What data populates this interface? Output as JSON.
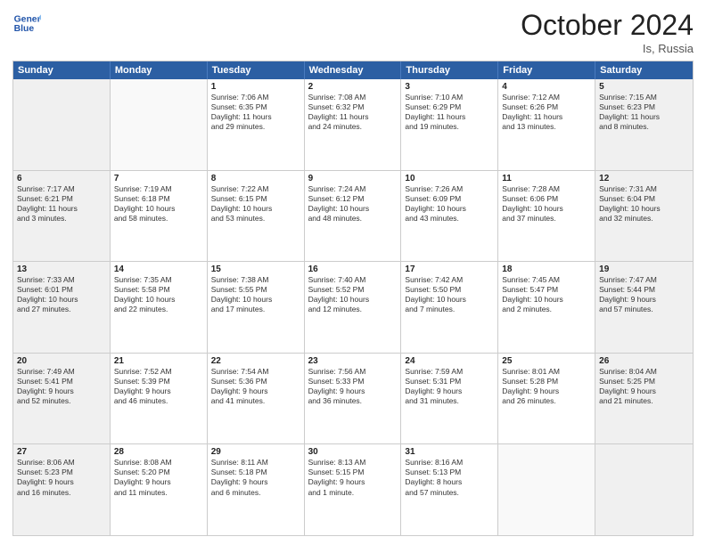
{
  "header": {
    "logo_line1": "General",
    "logo_line2": "Blue",
    "month": "October 2024",
    "location": "Is, Russia"
  },
  "days_of_week": [
    "Sunday",
    "Monday",
    "Tuesday",
    "Wednesday",
    "Thursday",
    "Friday",
    "Saturday"
  ],
  "weeks": [
    [
      {
        "day": "",
        "empty": true
      },
      {
        "day": "",
        "empty": true
      },
      {
        "day": "1",
        "lines": [
          "Sunrise: 7:06 AM",
          "Sunset: 6:35 PM",
          "Daylight: 11 hours",
          "and 29 minutes."
        ]
      },
      {
        "day": "2",
        "lines": [
          "Sunrise: 7:08 AM",
          "Sunset: 6:32 PM",
          "Daylight: 11 hours",
          "and 24 minutes."
        ]
      },
      {
        "day": "3",
        "lines": [
          "Sunrise: 7:10 AM",
          "Sunset: 6:29 PM",
          "Daylight: 11 hours",
          "and 19 minutes."
        ]
      },
      {
        "day": "4",
        "lines": [
          "Sunrise: 7:12 AM",
          "Sunset: 6:26 PM",
          "Daylight: 11 hours",
          "and 13 minutes."
        ]
      },
      {
        "day": "5",
        "lines": [
          "Sunrise: 7:15 AM",
          "Sunset: 6:23 PM",
          "Daylight: 11 hours",
          "and 8 minutes."
        ]
      }
    ],
    [
      {
        "day": "6",
        "lines": [
          "Sunrise: 7:17 AM",
          "Sunset: 6:21 PM",
          "Daylight: 11 hours",
          "and 3 minutes."
        ]
      },
      {
        "day": "7",
        "lines": [
          "Sunrise: 7:19 AM",
          "Sunset: 6:18 PM",
          "Daylight: 10 hours",
          "and 58 minutes."
        ]
      },
      {
        "day": "8",
        "lines": [
          "Sunrise: 7:22 AM",
          "Sunset: 6:15 PM",
          "Daylight: 10 hours",
          "and 53 minutes."
        ]
      },
      {
        "day": "9",
        "lines": [
          "Sunrise: 7:24 AM",
          "Sunset: 6:12 PM",
          "Daylight: 10 hours",
          "and 48 minutes."
        ]
      },
      {
        "day": "10",
        "lines": [
          "Sunrise: 7:26 AM",
          "Sunset: 6:09 PM",
          "Daylight: 10 hours",
          "and 43 minutes."
        ]
      },
      {
        "day": "11",
        "lines": [
          "Sunrise: 7:28 AM",
          "Sunset: 6:06 PM",
          "Daylight: 10 hours",
          "and 37 minutes."
        ]
      },
      {
        "day": "12",
        "lines": [
          "Sunrise: 7:31 AM",
          "Sunset: 6:04 PM",
          "Daylight: 10 hours",
          "and 32 minutes."
        ]
      }
    ],
    [
      {
        "day": "13",
        "lines": [
          "Sunrise: 7:33 AM",
          "Sunset: 6:01 PM",
          "Daylight: 10 hours",
          "and 27 minutes."
        ]
      },
      {
        "day": "14",
        "lines": [
          "Sunrise: 7:35 AM",
          "Sunset: 5:58 PM",
          "Daylight: 10 hours",
          "and 22 minutes."
        ]
      },
      {
        "day": "15",
        "lines": [
          "Sunrise: 7:38 AM",
          "Sunset: 5:55 PM",
          "Daylight: 10 hours",
          "and 17 minutes."
        ]
      },
      {
        "day": "16",
        "lines": [
          "Sunrise: 7:40 AM",
          "Sunset: 5:52 PM",
          "Daylight: 10 hours",
          "and 12 minutes."
        ]
      },
      {
        "day": "17",
        "lines": [
          "Sunrise: 7:42 AM",
          "Sunset: 5:50 PM",
          "Daylight: 10 hours",
          "and 7 minutes."
        ]
      },
      {
        "day": "18",
        "lines": [
          "Sunrise: 7:45 AM",
          "Sunset: 5:47 PM",
          "Daylight: 10 hours",
          "and 2 minutes."
        ]
      },
      {
        "day": "19",
        "lines": [
          "Sunrise: 7:47 AM",
          "Sunset: 5:44 PM",
          "Daylight: 9 hours",
          "and 57 minutes."
        ]
      }
    ],
    [
      {
        "day": "20",
        "lines": [
          "Sunrise: 7:49 AM",
          "Sunset: 5:41 PM",
          "Daylight: 9 hours",
          "and 52 minutes."
        ]
      },
      {
        "day": "21",
        "lines": [
          "Sunrise: 7:52 AM",
          "Sunset: 5:39 PM",
          "Daylight: 9 hours",
          "and 46 minutes."
        ]
      },
      {
        "day": "22",
        "lines": [
          "Sunrise: 7:54 AM",
          "Sunset: 5:36 PM",
          "Daylight: 9 hours",
          "and 41 minutes."
        ]
      },
      {
        "day": "23",
        "lines": [
          "Sunrise: 7:56 AM",
          "Sunset: 5:33 PM",
          "Daylight: 9 hours",
          "and 36 minutes."
        ]
      },
      {
        "day": "24",
        "lines": [
          "Sunrise: 7:59 AM",
          "Sunset: 5:31 PM",
          "Daylight: 9 hours",
          "and 31 minutes."
        ]
      },
      {
        "day": "25",
        "lines": [
          "Sunrise: 8:01 AM",
          "Sunset: 5:28 PM",
          "Daylight: 9 hours",
          "and 26 minutes."
        ]
      },
      {
        "day": "26",
        "lines": [
          "Sunrise: 8:04 AM",
          "Sunset: 5:25 PM",
          "Daylight: 9 hours",
          "and 21 minutes."
        ]
      }
    ],
    [
      {
        "day": "27",
        "lines": [
          "Sunrise: 8:06 AM",
          "Sunset: 5:23 PM",
          "Daylight: 9 hours",
          "and 16 minutes."
        ]
      },
      {
        "day": "28",
        "lines": [
          "Sunrise: 8:08 AM",
          "Sunset: 5:20 PM",
          "Daylight: 9 hours",
          "and 11 minutes."
        ]
      },
      {
        "day": "29",
        "lines": [
          "Sunrise: 8:11 AM",
          "Sunset: 5:18 PM",
          "Daylight: 9 hours",
          "and 6 minutes."
        ]
      },
      {
        "day": "30",
        "lines": [
          "Sunrise: 8:13 AM",
          "Sunset: 5:15 PM",
          "Daylight: 9 hours",
          "and 1 minute."
        ]
      },
      {
        "day": "31",
        "lines": [
          "Sunrise: 8:16 AM",
          "Sunset: 5:13 PM",
          "Daylight: 8 hours",
          "and 57 minutes."
        ]
      },
      {
        "day": "",
        "empty": true
      },
      {
        "day": "",
        "empty": true
      }
    ]
  ]
}
